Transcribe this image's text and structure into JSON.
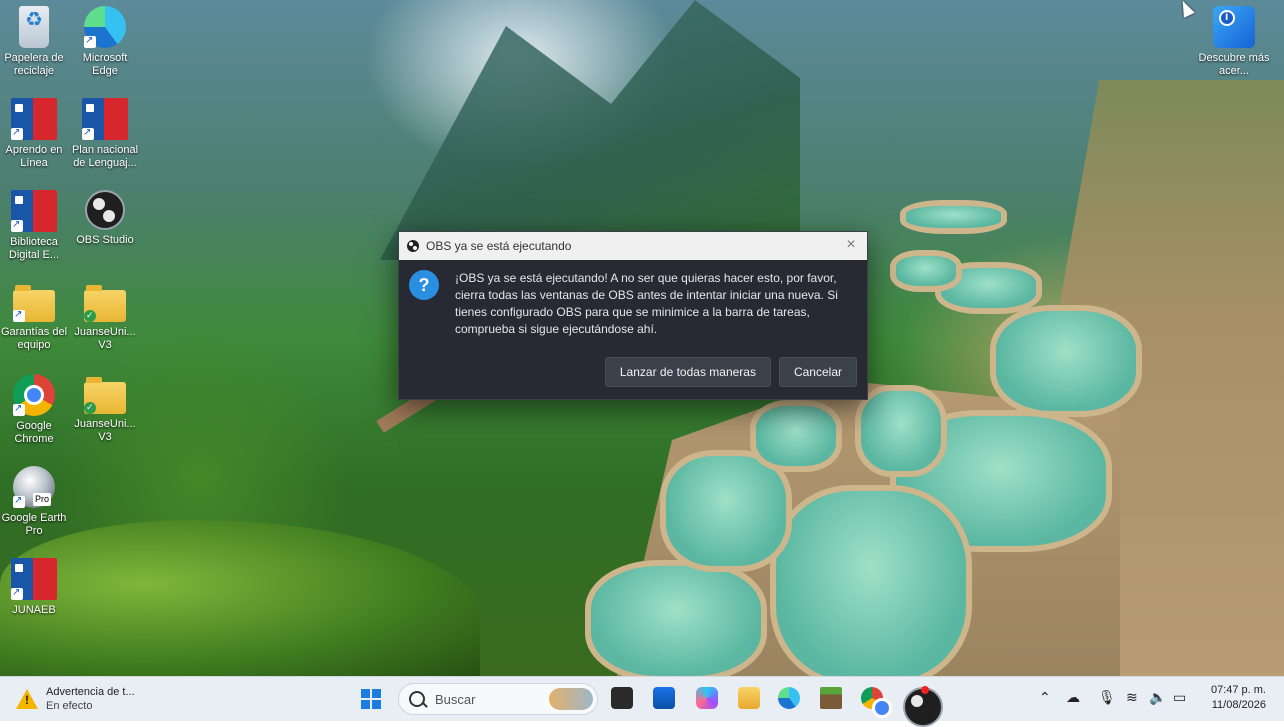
{
  "desktop": {
    "icons": [
      {
        "label": "Papelera de reciclaje"
      },
      {
        "label": "Microsoft Edge"
      },
      {
        "label": "Aprendo en Línea"
      },
      {
        "label": "Plan nacional de Lenguaj..."
      },
      {
        "label": "Biblioteca Digital E..."
      },
      {
        "label": "OBS Studio"
      },
      {
        "label": "Garantías del equipo"
      },
      {
        "label": "JuanseUni... V3"
      },
      {
        "label": "Google Chrome"
      },
      {
        "label": "JuanseUni... V3"
      },
      {
        "label": "Google Earth Pro"
      },
      {
        "label": "JUNAEB"
      },
      {
        "label": "Descubre más acer..."
      }
    ],
    "earth_badge": "Pro"
  },
  "dialog": {
    "title": "OBS ya se está ejecutando",
    "icon": "question-icon",
    "message": "¡OBS ya se está ejecutando! A no ser que quieras hacer esto, por favor, cierra todas las ventanas de OBS antes de intentar iniciar una nueva. Si tienes configurado OBS para que se minimice a la barra de tareas, comprueba si sigue ejecutándose ahí.",
    "buttons": {
      "launch": "Lanzar de todas maneras",
      "cancel": "Cancelar"
    }
  },
  "taskbar": {
    "weather": {
      "title": "Advertencia de t...",
      "subtitle": "En efecto"
    },
    "search_placeholder": "Buscar",
    "clock": {
      "time": "07:47 p. m.",
      "date": "11/08/2026"
    }
  },
  "colors": {
    "dialog_bg": "#272a33",
    "accent": "#2a8fe0",
    "taskbar_bg": "#e9eef4"
  }
}
